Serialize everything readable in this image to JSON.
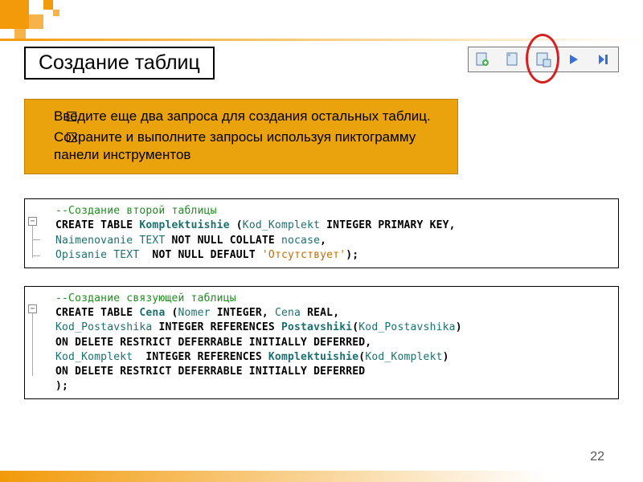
{
  "title": "Создание таблиц",
  "toolbar_icons": [
    "new-query-icon",
    "open-icon",
    "save-run-icon",
    "play-icon",
    "play-all-icon"
  ],
  "instructions": [
    "Введите еще два запроса для создания остальных таблиц.",
    "Сохраните и выполните запросы используя пиктограмму панели инструментов"
  ],
  "code1": {
    "comment": "--Создание второй таблицы",
    "l1a": "CREATE TABLE",
    "l1b": "Komplektuishie",
    "l1c": "(",
    "l1d": "Kod_Komplekt",
    "l1e": "INTEGER PRIMARY KEY",
    "l1f": ",",
    "l2a": "Naimenovanie",
    "l2b": "TEXT",
    "l2c": "NOT NULL COLLATE",
    "l2d": "nocase",
    "l2e": ",",
    "l3a": "Opisanie",
    "l3b": "TEXT",
    "l3c": "NOT NULL DEFAULT",
    "l3d": "'Отсутствует'",
    "l3e": ");"
  },
  "code2": {
    "comment": "--Создание связующей таблицы",
    "l1a": "CREATE TABLE",
    "l1b": "Cena",
    "l1c": "(",
    "l1d": "Nomer",
    "l1e": "INTEGER",
    "l1f": ",",
    "l1g": "Cena",
    "l1h": "REAL",
    "l1i": ",",
    "l2a": "Kod_Postavshika",
    "l2b": "INTEGER REFERENCES",
    "l2c": "Postavshiki",
    "l2d": "(",
    "l2e": "Kod_Postavshika",
    "l2f": ")",
    "l3": "ON DELETE RESTRICT DEFERRABLE INITIALLY DEFERRED",
    "l3e": ",",
    "l4a": "Kod_Komplekt",
    "l4b": "INTEGER REFERENCES",
    "l4c": "Komplektuishie",
    "l4d": "(",
    "l4e": "Kod_Komplekt",
    "l4f": ")",
    "l5": "ON DELETE RESTRICT DEFERRABLE INITIALLY DEFERRED",
    "l6": ");"
  },
  "page_number": "22"
}
